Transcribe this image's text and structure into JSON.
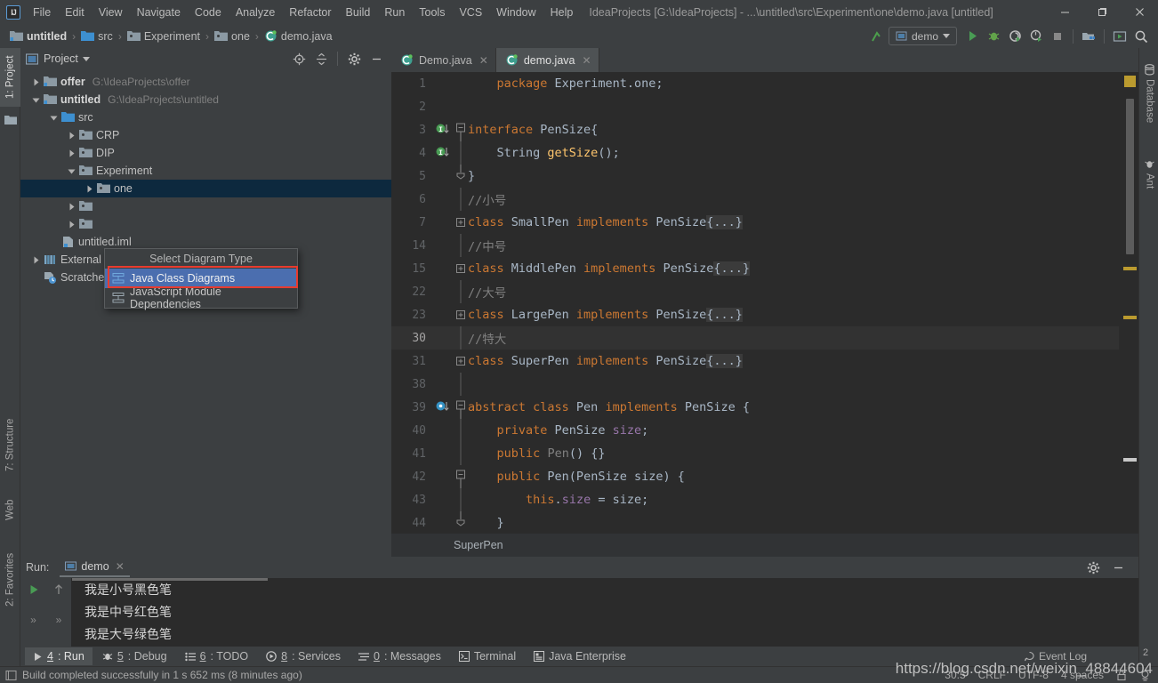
{
  "window": {
    "title": "IdeaProjects [G:\\IdeaProjects] - ...\\untitled\\src\\Experiment\\one\\demo.java [untitled]",
    "minimize": "—",
    "maximize": "❐",
    "close": "✕"
  },
  "menubar": [
    {
      "label": "File"
    },
    {
      "label": "Edit"
    },
    {
      "label": "View"
    },
    {
      "label": "Navigate"
    },
    {
      "label": "Code"
    },
    {
      "label": "Analyze"
    },
    {
      "label": "Refactor"
    },
    {
      "label": "Build"
    },
    {
      "label": "Run"
    },
    {
      "label": "Tools"
    },
    {
      "label": "VCS"
    },
    {
      "label": "Window"
    },
    {
      "label": "Help"
    }
  ],
  "breadcrumb": [
    {
      "label": "untitled",
      "icon": "module-icon"
    },
    {
      "label": "src",
      "icon": "source-folder-icon"
    },
    {
      "label": "Experiment",
      "icon": "package-icon"
    },
    {
      "label": "one",
      "icon": "package-icon"
    },
    {
      "label": "demo.java",
      "icon": "java-class-icon"
    }
  ],
  "toolbar": {
    "run_config": "demo",
    "buttons": [
      "build-icon",
      "run-icon",
      "debug-icon",
      "run-coverage-icon",
      "profile-icon",
      "stop-icon",
      "project-structure-icon",
      "update-icon",
      "search-everywhere-icon"
    ]
  },
  "left_tool_strip": [
    {
      "label": "1: Project",
      "selected": true
    },
    {
      "label": "7: Structure",
      "selected": false
    },
    {
      "label": "Web",
      "selected": false
    },
    {
      "label": "2: Favorites",
      "selected": false
    }
  ],
  "right_tool_strip": [
    {
      "label": "Database"
    },
    {
      "label": "Ant"
    }
  ],
  "project_panel": {
    "title": "Project",
    "header_icons": [
      "locate-icon",
      "collapse-all-icon",
      "settings-icon",
      "hide-icon"
    ],
    "tree": [
      {
        "label": "offer",
        "path": "G:\\IdeaProjects\\offer",
        "indent": 0,
        "arrow": "right",
        "icon": "module-icon",
        "bold": true,
        "selected": false
      },
      {
        "label": "untitled",
        "path": "G:\\IdeaProjects\\untitled",
        "indent": 0,
        "arrow": "down",
        "icon": "module-icon",
        "bold": true,
        "selected": false
      },
      {
        "label": "src",
        "path": "",
        "indent": 1,
        "arrow": "down",
        "icon": "source-folder-icon",
        "bold": false,
        "selected": false
      },
      {
        "label": "CRP",
        "path": "",
        "indent": 2,
        "arrow": "right",
        "icon": "package-icon",
        "bold": false,
        "selected": false
      },
      {
        "label": "DIP",
        "path": "",
        "indent": 2,
        "arrow": "right",
        "icon": "package-icon",
        "bold": false,
        "selected": false
      },
      {
        "label": "Experiment",
        "path": "",
        "indent": 2,
        "arrow": "down",
        "icon": "package-icon",
        "bold": false,
        "selected": false
      },
      {
        "label": "one",
        "path": "",
        "indent": 3,
        "arrow": "right",
        "icon": "package-icon",
        "bold": false,
        "selected": true
      },
      {
        "label": "",
        "path": "",
        "indent": 2,
        "arrow": "right",
        "icon": "package-icon",
        "bold": false,
        "selected": false
      },
      {
        "label": "",
        "path": "",
        "indent": 2,
        "arrow": "right",
        "icon": "package-icon",
        "bold": false,
        "selected": false
      },
      {
        "label": "untitled.iml",
        "path": "",
        "indent": 1,
        "arrow": "none",
        "icon": "iml-file-icon",
        "bold": false,
        "selected": false
      },
      {
        "label": "External Libraries",
        "path": "",
        "indent": 0,
        "arrow": "right",
        "icon": "libraries-icon",
        "bold": false,
        "selected": false
      },
      {
        "label": "Scratches and Consoles",
        "path": "",
        "indent": 0,
        "arrow": "none",
        "icon": "scratches-icon",
        "bold": false,
        "selected": false
      }
    ]
  },
  "popup": {
    "title": "Select Diagram Type",
    "items": [
      {
        "label": "Java Class Diagrams",
        "selected": true,
        "icon": "diagram-icon"
      },
      {
        "label": "JavaScript Module Dependencies",
        "selected": false,
        "icon": "diagram-icon"
      }
    ]
  },
  "editor": {
    "tabs": [
      {
        "label": "Demo.java",
        "active": false,
        "icon": "java-class-icon"
      },
      {
        "label": "demo.java",
        "active": true,
        "icon": "java-class-icon"
      }
    ],
    "breadcrumb": "SuperPen",
    "lines": [
      {
        "n": "1",
        "marker": "",
        "fold": "",
        "current": false,
        "tokens": [
          {
            "t": "    ",
            "c": "plain"
          },
          {
            "t": "package",
            "c": "kw"
          },
          {
            "t": " Experiment.one;",
            "c": "plain"
          }
        ]
      },
      {
        "n": "2",
        "marker": "",
        "fold": "",
        "current": false,
        "tokens": []
      },
      {
        "n": "3",
        "marker": "impl",
        "fold": "minus",
        "current": false,
        "tokens": [
          {
            "t": "interface",
            "c": "kw"
          },
          {
            "t": " PenSize{",
            "c": "plain"
          }
        ]
      },
      {
        "n": "4",
        "marker": "impl",
        "fold": "",
        "current": false,
        "tokens": [
          {
            "t": "    String ",
            "c": "plain"
          },
          {
            "t": "getSize",
            "c": "fn"
          },
          {
            "t": "();",
            "c": "plain"
          }
        ]
      },
      {
        "n": "5",
        "marker": "",
        "fold": "end",
        "current": false,
        "tokens": [
          {
            "t": "}",
            "c": "plain"
          }
        ]
      },
      {
        "n": "6",
        "marker": "",
        "fold": "",
        "current": false,
        "tokens": [
          {
            "t": "//小号",
            "c": "cm"
          }
        ]
      },
      {
        "n": "7",
        "marker": "",
        "fold": "plus",
        "current": false,
        "tokens": [
          {
            "t": "class",
            "c": "kw"
          },
          {
            "t": " SmallPen ",
            "c": "plain"
          },
          {
            "t": "implements",
            "c": "kw"
          },
          {
            "t": " PenSize",
            "c": "plain"
          },
          {
            "t": "{...}",
            "c": "folded"
          }
        ]
      },
      {
        "n": "14",
        "marker": "",
        "fold": "",
        "current": false,
        "tokens": [
          {
            "t": "//中号",
            "c": "cm"
          }
        ]
      },
      {
        "n": "15",
        "marker": "",
        "fold": "plus",
        "current": false,
        "tokens": [
          {
            "t": "class",
            "c": "kw"
          },
          {
            "t": " MiddlePen ",
            "c": "plain"
          },
          {
            "t": "implements",
            "c": "kw"
          },
          {
            "t": " PenSize",
            "c": "plain"
          },
          {
            "t": "{...}",
            "c": "folded"
          }
        ]
      },
      {
        "n": "22",
        "marker": "",
        "fold": "",
        "current": false,
        "tokens": [
          {
            "t": "//大号",
            "c": "cm"
          }
        ]
      },
      {
        "n": "23",
        "marker": "",
        "fold": "plus",
        "current": false,
        "tokens": [
          {
            "t": "class",
            "c": "kw"
          },
          {
            "t": " LargePen ",
            "c": "plain"
          },
          {
            "t": "implements",
            "c": "kw"
          },
          {
            "t": " PenSize",
            "c": "plain"
          },
          {
            "t": "{...}",
            "c": "folded"
          }
        ]
      },
      {
        "n": "30",
        "marker": "",
        "fold": "",
        "current": true,
        "tokens": [
          {
            "t": "//特大",
            "c": "cm"
          }
        ]
      },
      {
        "n": "31",
        "marker": "",
        "fold": "plus",
        "current": false,
        "tokens": [
          {
            "t": "class",
            "c": "kw"
          },
          {
            "t": " SuperPen ",
            "c": "plain"
          },
          {
            "t": "implements",
            "c": "kw"
          },
          {
            "t": " PenSize",
            "c": "plain"
          },
          {
            "t": "{...}",
            "c": "folded"
          }
        ]
      },
      {
        "n": "38",
        "marker": "",
        "fold": "",
        "current": false,
        "tokens": []
      },
      {
        "n": "39",
        "marker": "override",
        "fold": "minus",
        "current": false,
        "tokens": [
          {
            "t": "abstract class",
            "c": "kw"
          },
          {
            "t": " Pen ",
            "c": "plain"
          },
          {
            "t": "implements",
            "c": "kw"
          },
          {
            "t": " PenSize {",
            "c": "plain"
          }
        ]
      },
      {
        "n": "40",
        "marker": "",
        "fold": "",
        "current": false,
        "tokens": [
          {
            "t": "    ",
            "c": "plain"
          },
          {
            "t": "private",
            "c": "kw"
          },
          {
            "t": " PenSize ",
            "c": "plain"
          },
          {
            "t": "size",
            "c": "fld"
          },
          {
            "t": ";",
            "c": "plain"
          }
        ]
      },
      {
        "n": "41",
        "marker": "",
        "fold": "",
        "current": false,
        "tokens": [
          {
            "t": "    ",
            "c": "plain"
          },
          {
            "t": "public",
            "c": "kw"
          },
          {
            "t": " ",
            "c": "plain"
          },
          {
            "t": "Pen",
            "c": "cm"
          },
          {
            "t": "() {}",
            "c": "plain"
          }
        ]
      },
      {
        "n": "42",
        "marker": "",
        "fold": "minus2",
        "current": false,
        "tokens": [
          {
            "t": "    ",
            "c": "plain"
          },
          {
            "t": "public",
            "c": "kw"
          },
          {
            "t": " Pen(PenSize size) {",
            "c": "plain"
          }
        ]
      },
      {
        "n": "43",
        "marker": "",
        "fold": "",
        "current": false,
        "tokens": [
          {
            "t": "        ",
            "c": "plain"
          },
          {
            "t": "this",
            "c": "kw"
          },
          {
            "t": ".",
            "c": "plain"
          },
          {
            "t": "size",
            "c": "fld"
          },
          {
            "t": " = size;",
            "c": "plain"
          }
        ]
      },
      {
        "n": "44",
        "marker": "",
        "fold": "end",
        "current": false,
        "tokens": [
          {
            "t": "    }",
            "c": "plain"
          }
        ]
      }
    ]
  },
  "run_panel": {
    "label": "Run:",
    "tab": "demo",
    "console_lines": [
      "我是小号黑色笔",
      "我是中号红色笔",
      "我是大号绿色笔"
    ],
    "header_icons": [
      "settings-icon",
      "hide-icon"
    ],
    "gutter_icons": [
      "rerun-icon",
      "scroll-up-icon",
      "expand-icon",
      "expand2-icon"
    ]
  },
  "bottom_tabs": [
    {
      "num": "4",
      "label": ": Run",
      "icon": "run-icon",
      "selected": true
    },
    {
      "num": "5",
      "label": ": Debug",
      "icon": "debug-icon",
      "selected": false
    },
    {
      "num": "6",
      "label": ": TODO",
      "icon": "todo-icon",
      "selected": false
    },
    {
      "num": "8",
      "label": ": Services",
      "icon": "services-icon",
      "selected": false
    },
    {
      "num": "0",
      "label": ": Messages",
      "icon": "messages-icon",
      "selected": false
    },
    {
      "num": "",
      "label": "Terminal",
      "icon": "terminal-icon",
      "selected": false
    },
    {
      "num": "",
      "label": "Java Enterprise",
      "icon": "java-enterprise-icon",
      "selected": false
    }
  ],
  "status_bar": {
    "message": "Build completed successfully in 1 s 652 ms (8 minutes ago)",
    "caret": "30:5",
    "line_sep": "CRLF",
    "encoding": "UTF-8",
    "indent": "4 spaces",
    "event_log": "Event Log"
  },
  "watermark": "https://blog.csdn.net/weixin_48844604",
  "colors": {
    "accent_blue": "#4b6eaf",
    "selection": "#0d293e",
    "red_highlight": "#e83b2f",
    "editor_bg": "#2b2b2b",
    "panel_bg": "#3c3f41",
    "keyword": "#cc7832",
    "comment": "#808080",
    "method": "#ffc66d",
    "field": "#9876aa"
  }
}
